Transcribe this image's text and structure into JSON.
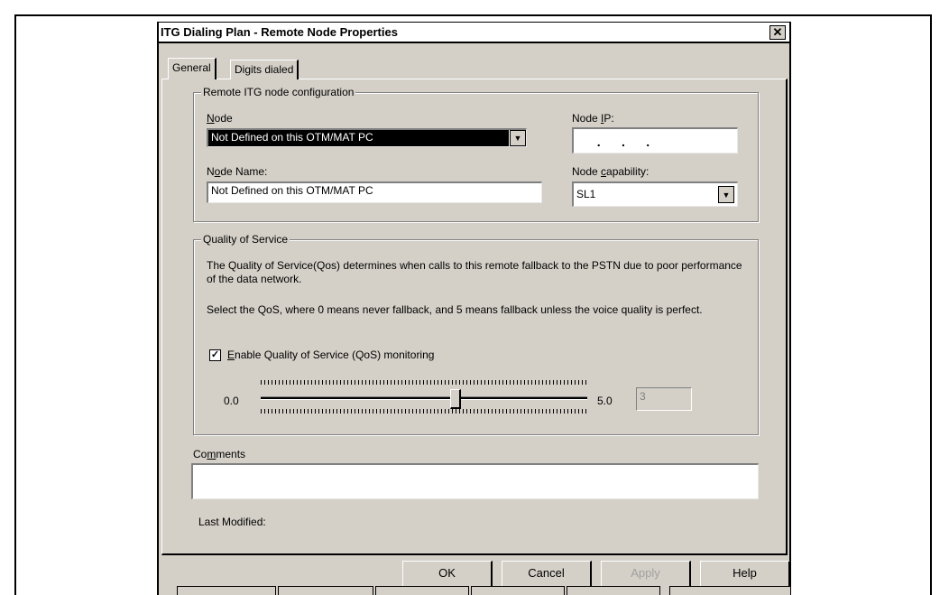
{
  "dialog": {
    "title": "ITG Dialing Plan - Remote Node Properties",
    "close_symbol": "✕",
    "tabs": [
      {
        "label": "General"
      },
      {
        "label": "Digits dialed"
      }
    ]
  },
  "remote_node": {
    "group_label": "Remote ITG node configuration",
    "node_label_prefix": "",
    "node_label_key": "N",
    "node_label_rest": "ode",
    "node_value": "Not Defined on this OTM/MAT PC",
    "node_ip_label_prefix": "Node ",
    "node_ip_label_key": "I",
    "node_ip_label_rest": "P:",
    "node_ip_value": "  .      .      .",
    "node_name_label_prefix": "N",
    "node_name_label_key": "o",
    "node_name_label_rest": "de Name:",
    "node_name_value": "Not Defined on this OTM/MAT PC",
    "node_capability_label_prefix": "Node ",
    "node_capability_label_key": "c",
    "node_capability_label_rest": "apability:",
    "node_capability_value": "SL1"
  },
  "qos": {
    "group_label": "Quality of Service",
    "description_1": "The Quality of Service(Qos) determines when calls to this remote fallback to the PSTN due to poor performance of the data network.",
    "description_2": "Select the QoS, where 0 means never fallback, and 5 means fallback unless the voice quality is perfect.",
    "enable_checked": true,
    "enable_check_mark": "✓",
    "enable_label_key": "E",
    "enable_label_rest": "nable Quality of Service (QoS) monitoring",
    "slider_min_label": "0.0",
    "slider_max_label": "5.0",
    "slider_value": 3,
    "slider_min": 0,
    "slider_max": 5,
    "value_field": "3"
  },
  "comments": {
    "label_prefix": "Co",
    "label_key": "m",
    "label_rest": "ments",
    "value": ""
  },
  "last_modified": {
    "label": "Last Modified:"
  },
  "buttons": {
    "ok": "OK",
    "cancel": "Cancel",
    "apply": "Apply",
    "help": "Help"
  },
  "icons": {
    "dropdown": "▼"
  }
}
